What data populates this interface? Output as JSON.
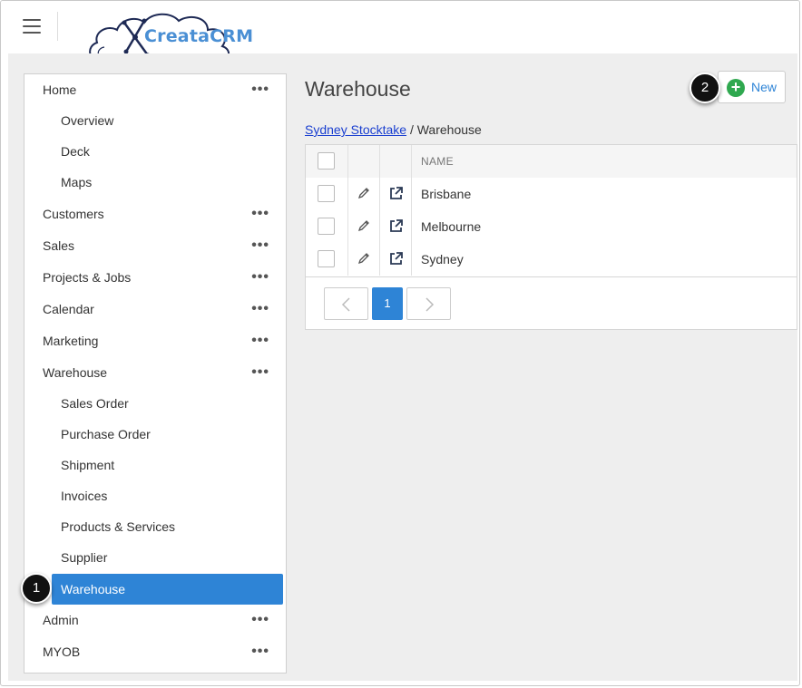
{
  "app": {
    "logo_text": "CreataCRM"
  },
  "sidebar": {
    "items": [
      {
        "label": "Home",
        "more": "•••"
      },
      {
        "label": "Overview"
      },
      {
        "label": "Deck"
      },
      {
        "label": "Maps"
      },
      {
        "label": "Customers",
        "more": "•••"
      },
      {
        "label": "Sales",
        "more": "•••"
      },
      {
        "label": "Projects & Jobs",
        "more": "•••"
      },
      {
        "label": "Calendar",
        "more": "•••"
      },
      {
        "label": "Marketing",
        "more": "•••"
      },
      {
        "label": "Warehouse",
        "more": "•••"
      },
      {
        "label": "Sales Order"
      },
      {
        "label": "Purchase Order"
      },
      {
        "label": "Shipment"
      },
      {
        "label": "Invoices"
      },
      {
        "label": "Products & Services"
      },
      {
        "label": "Supplier"
      },
      {
        "label": "Warehouse",
        "active": true
      },
      {
        "label": "Admin",
        "more": "•••"
      },
      {
        "label": "MYOB",
        "more": "•••"
      }
    ]
  },
  "annotations": {
    "step1": "1",
    "step2": "2"
  },
  "main": {
    "title": "Warehouse",
    "new_label": "New",
    "breadcrumb": {
      "link": "Sydney Stocktake",
      "separator": "/",
      "current": "Warehouse"
    },
    "grid": {
      "header_name": "NAME",
      "rows": [
        {
          "name": "Brisbane"
        },
        {
          "name": "Melbourne"
        },
        {
          "name": "Sydney"
        }
      ]
    },
    "pagination": {
      "current_page": "1"
    }
  },
  "colors": {
    "accent": "#2e84d6",
    "new_icon": "#2fa84f",
    "link": "#1a3fd0"
  }
}
